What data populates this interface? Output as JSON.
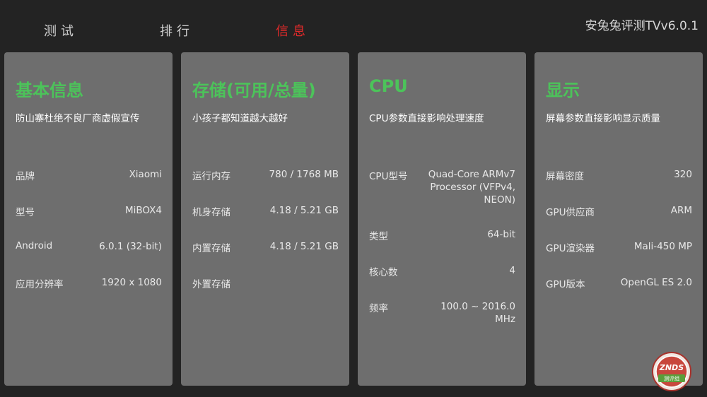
{
  "tabs": [
    {
      "label": "测试",
      "active": false
    },
    {
      "label": "排行",
      "active": false
    },
    {
      "label": "信息",
      "active": true
    }
  ],
  "app_title": "安兔兔评测TVv6.0.1",
  "colors": {
    "background": "#232323",
    "card": "#6e6e6e",
    "accent_green": "#4cc35a",
    "active_tab": "#e02a2a"
  },
  "cards": [
    {
      "title": "基本信息",
      "subtitle": "防山寨杜绝不良厂商虚假宣传",
      "rows": [
        {
          "label": "品牌",
          "value": "Xiaomi"
        },
        {
          "label": "型号",
          "value": "MiBOX4"
        },
        {
          "label": "Android",
          "value": "6.0.1 (32-bit)"
        },
        {
          "label": "应用分辨率",
          "value": "1920 x 1080"
        }
      ]
    },
    {
      "title": "存储(可用/总量)",
      "subtitle": "小孩子都知道越大越好",
      "rows": [
        {
          "label": "运行内存",
          "value": "780 / 1768 MB"
        },
        {
          "label": "机身存储",
          "value": "4.18 / 5.21 GB"
        },
        {
          "label": "内置存储",
          "value": "4.18 / 5.21 GB"
        },
        {
          "label": "外置存储",
          "value": ""
        }
      ]
    },
    {
      "title": "CPU",
      "subtitle": "CPU参数直接影响处理速度",
      "rows": [
        {
          "label": "CPU型号",
          "value": "Quad-Core ARMv7 Processor (VFPv4, NEON)"
        },
        {
          "label": "类型",
          "value": "64-bit"
        },
        {
          "label": "核心数",
          "value": "4"
        },
        {
          "label": "频率",
          "value": "100.0 ~ 2016.0 MHz"
        }
      ]
    },
    {
      "title": "显示",
      "subtitle": "屏幕参数直接影响显示质量",
      "rows": [
        {
          "label": "屏幕密度",
          "value": "320"
        },
        {
          "label": "GPU供应商",
          "value": "ARM"
        },
        {
          "label": "GPU渲染器",
          "value": "Mali-450 MP"
        },
        {
          "label": "GPU版本",
          "value": "OpenGL ES 2.0"
        }
      ]
    }
  ],
  "watermark": {
    "top_text": "ZNDS",
    "bottom_text": "测评组"
  }
}
